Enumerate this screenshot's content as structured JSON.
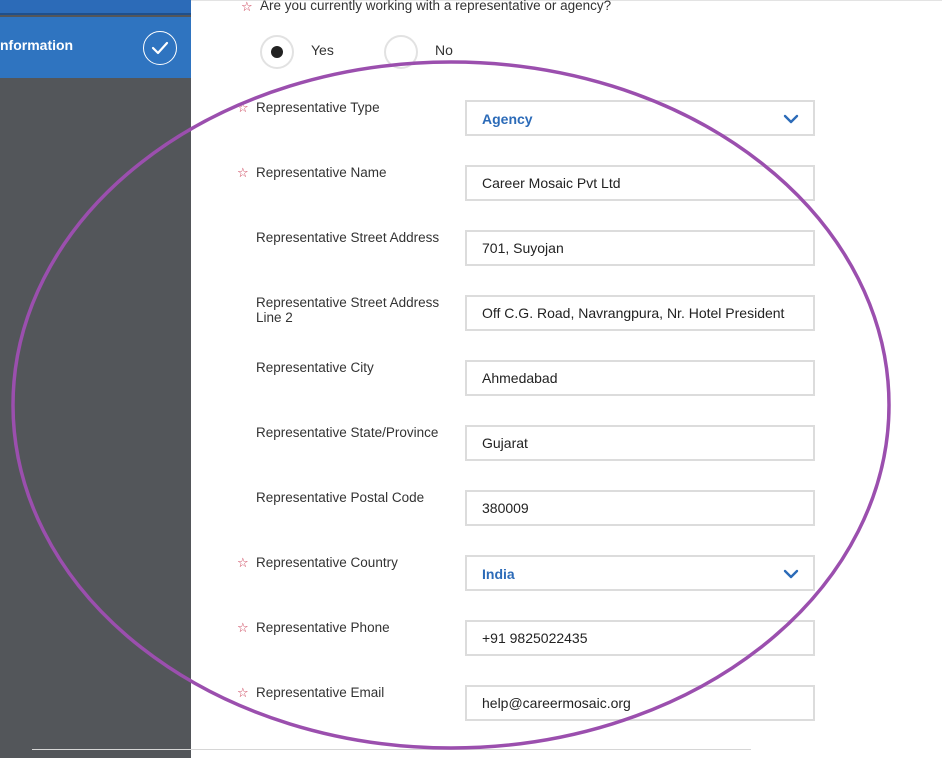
{
  "sidebar": {
    "active_item_label": "nformation"
  },
  "question": {
    "text": "Are you currently working with a representative or agency?",
    "required_mark": "☆",
    "options": [
      {
        "label": "Yes",
        "selected": true
      },
      {
        "label": "No",
        "selected": false
      }
    ]
  },
  "form": {
    "rep_type": {
      "label": "Representative Type",
      "value": "Agency",
      "required_mark": "☆"
    },
    "rep_name": {
      "label": "Representative Name",
      "value": "Career Mosaic Pvt Ltd",
      "required_mark": "☆"
    },
    "rep_street": {
      "label": "Representative Street Address",
      "value": "701, Suyojan"
    },
    "rep_street2": {
      "label": "Representative Street Address Line 2",
      "value": "Off C.G. Road, Navrangpura, Nr. Hotel President"
    },
    "rep_city": {
      "label": "Representative City",
      "value": "Ahmedabad"
    },
    "rep_state": {
      "label": "Representative State/Province",
      "value": "Gujarat"
    },
    "rep_postal": {
      "label": "Representative Postal Code",
      "value": "380009"
    },
    "rep_country": {
      "label": "Representative Country",
      "value": "India",
      "required_mark": "☆"
    },
    "rep_phone": {
      "label": "Representative Phone",
      "value": "+91 9825022435",
      "required_mark": "☆"
    },
    "rep_email": {
      "label": "Representative Email",
      "value": "help@careermosaic.org",
      "required_mark": "☆"
    }
  },
  "colors": {
    "sidebar_bg": "#53565a",
    "sidebar_active": "#2f74c0",
    "accent_blue": "#2c6bb8",
    "required_red": "#c8374f",
    "annotation_purple": "#9b4fae"
  },
  "icons": {
    "check": "check-icon",
    "chevron": "chevron-down-icon"
  }
}
